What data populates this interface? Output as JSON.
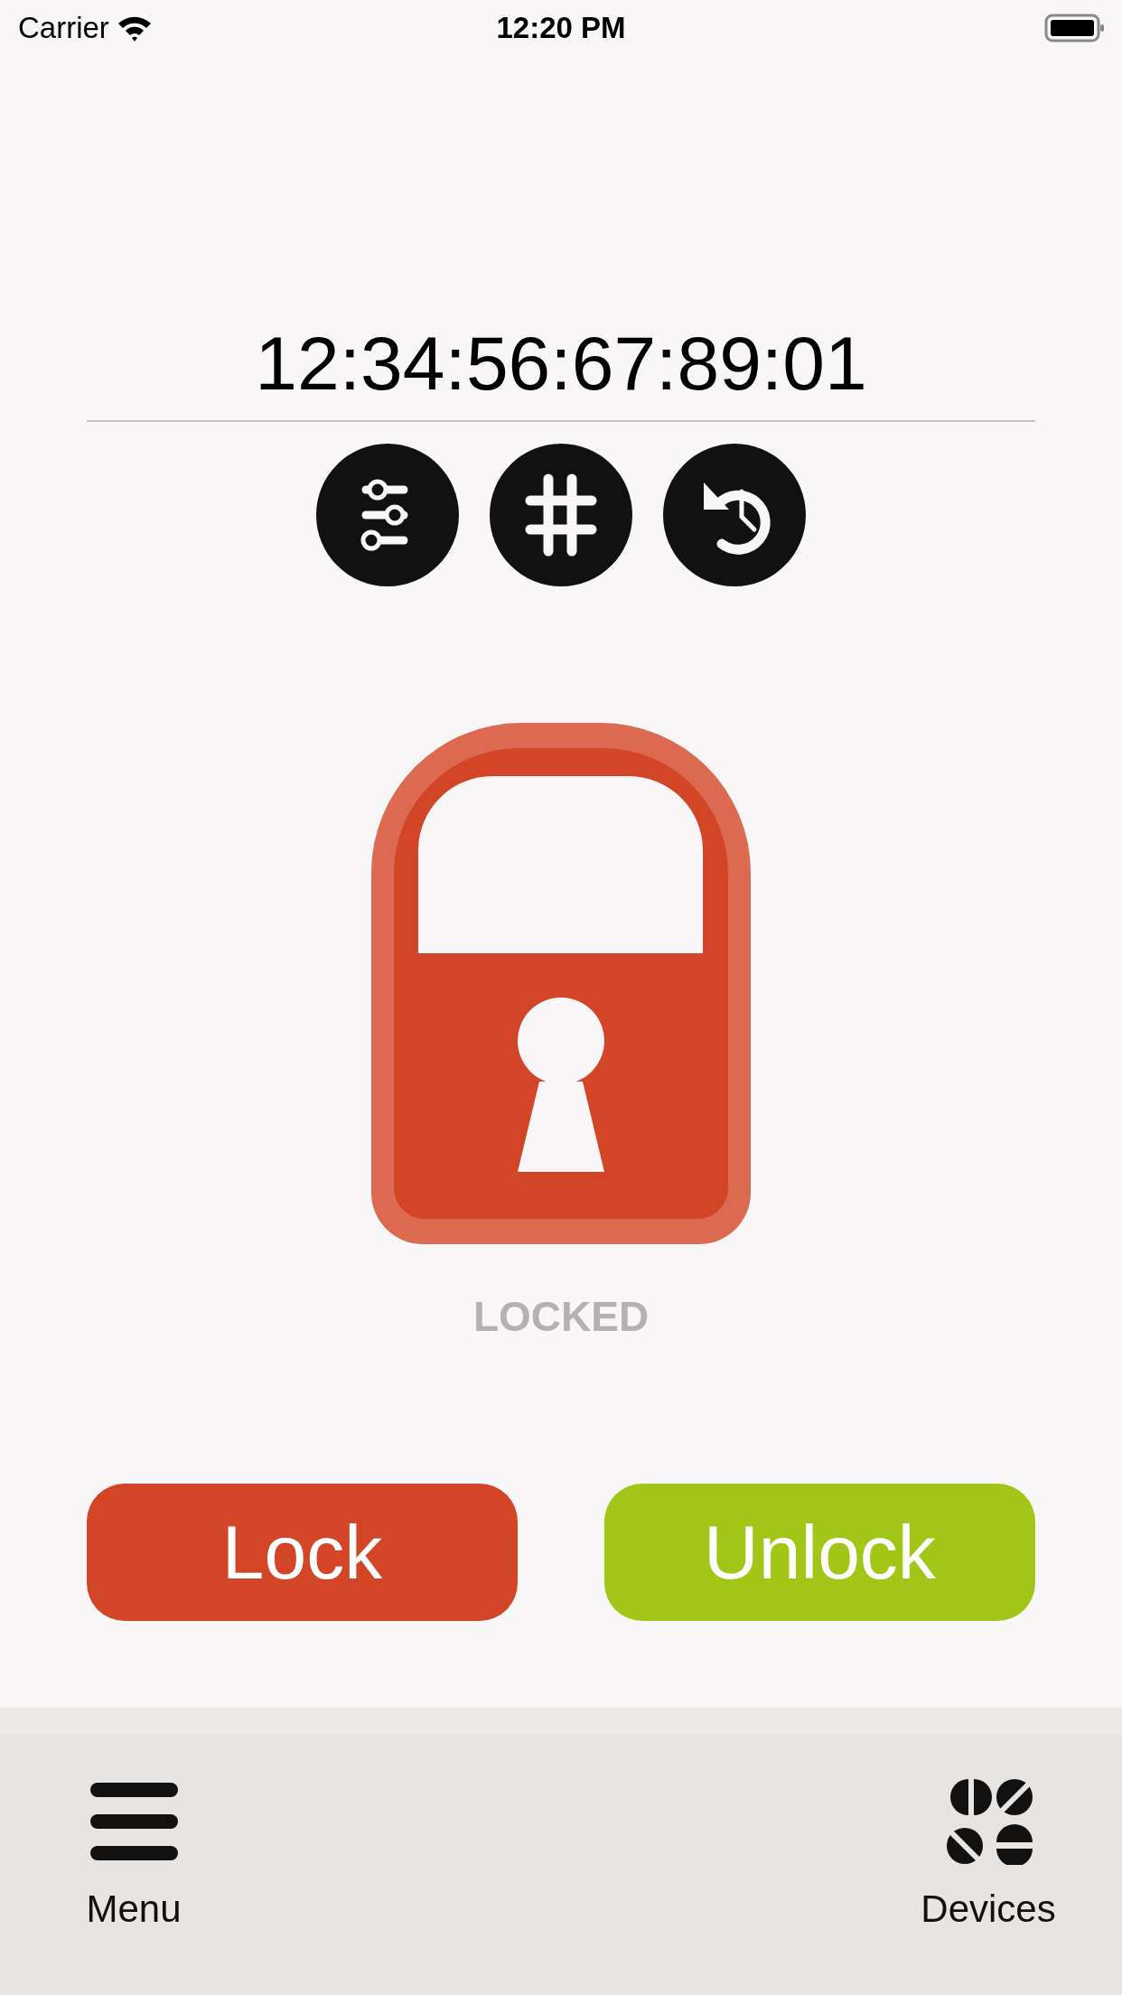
{
  "status_bar": {
    "carrier": "Carrier",
    "time": "12:20 PM"
  },
  "device_address": "12:34:56:67:89:01",
  "actions": [
    {
      "kind": "settings"
    },
    {
      "kind": "code"
    },
    {
      "kind": "history"
    }
  ],
  "lock": {
    "locked": true,
    "label": "LOCKED"
  },
  "buttons": [
    {
      "label": "Lock",
      "kind": "lock"
    },
    {
      "label": "Unlock",
      "kind": "unlock"
    }
  ],
  "tab_bar": [
    {
      "label": "Menu",
      "kind": "menu"
    },
    {
      "label": "Devices",
      "kind": "devices"
    }
  ]
}
